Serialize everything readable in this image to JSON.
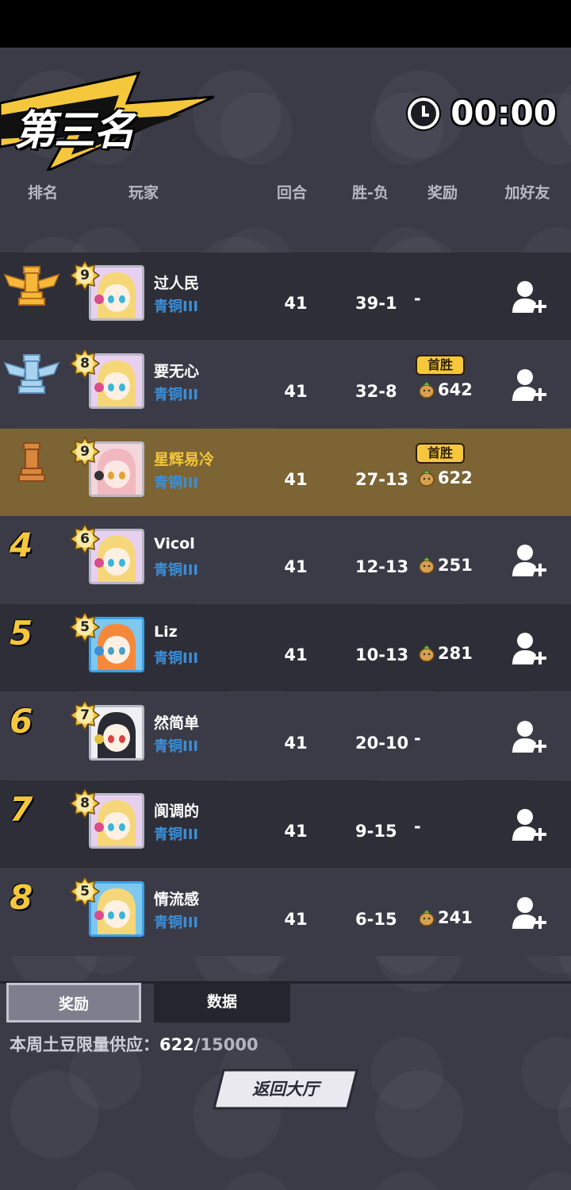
{
  "title": "第三名",
  "timer": "00:00",
  "headers": {
    "rank": "排名",
    "player": "玩家",
    "rounds": "回合",
    "wl": "胜-负",
    "reward": "奖励",
    "add_friend": "加好友"
  },
  "first_win_label": "首胜",
  "rows": [
    {
      "rank": "1",
      "trophy": "gold-rook",
      "level": "9",
      "name": "过人民",
      "tier": "青铜III",
      "rounds": "41",
      "wl": "39-1",
      "reward": "-",
      "avatar": "blonde-cat-ear-girl"
    },
    {
      "rank": "2",
      "trophy": "silver-rook",
      "level": "8",
      "name": "要无心",
      "tier": "青铜III",
      "rounds": "41",
      "wl": "32-8",
      "reward": "642",
      "first_win": true,
      "avatar": "blonde-cat-ear-girl"
    },
    {
      "rank": "3",
      "trophy": "bronze-rook",
      "level": "9",
      "name": "星辉易冷",
      "tier": "青铜III",
      "rounds": "41",
      "wl": "27-13",
      "reward": "622",
      "first_win": true,
      "avatar": "pink-hair-masked-girl",
      "me": true
    },
    {
      "rank": "4",
      "level": "6",
      "name": "Vicol",
      "tier": "青铜III",
      "rounds": "41",
      "wl": "12-13",
      "reward": "251",
      "avatar": "blonde-cat-ear-girl"
    },
    {
      "rank": "5",
      "level": "5",
      "name": "Liz",
      "tier": "青铜III",
      "rounds": "41",
      "wl": "10-13",
      "reward": "281",
      "avatar": "orange-hair-summer"
    },
    {
      "rank": "6",
      "level": "7",
      "name": "然简单",
      "tier": "青铜III",
      "rounds": "41",
      "wl": "20-10",
      "reward": "-",
      "avatar": "black-hair-captain"
    },
    {
      "rank": "7",
      "level": "8",
      "name": "阆调的",
      "tier": "青铜III",
      "rounds": "41",
      "wl": "9-15",
      "reward": "-",
      "avatar": "blonde-cat-ear-girl"
    },
    {
      "rank": "8",
      "level": "5",
      "name": "情流感",
      "tier": "青铜III",
      "rounds": "41",
      "wl": "6-15",
      "reward": "241",
      "avatar": "blonde-summer"
    }
  ],
  "tabs": {
    "rewards": "奖励",
    "stats": "数据"
  },
  "supply": {
    "label": "本周土豆限量供应：",
    "current": "622",
    "max": "/15000"
  },
  "back_button": "返回大厅",
  "colors": {
    "accent_gold": "#f4c73c",
    "tier_blue": "#3a8fd8",
    "highlight_row": "#7d6434",
    "bg": "#3b3b48"
  },
  "icons": {
    "timer": "clock-icon",
    "reward": "potato-icon",
    "add": "add-friend-icon"
  }
}
